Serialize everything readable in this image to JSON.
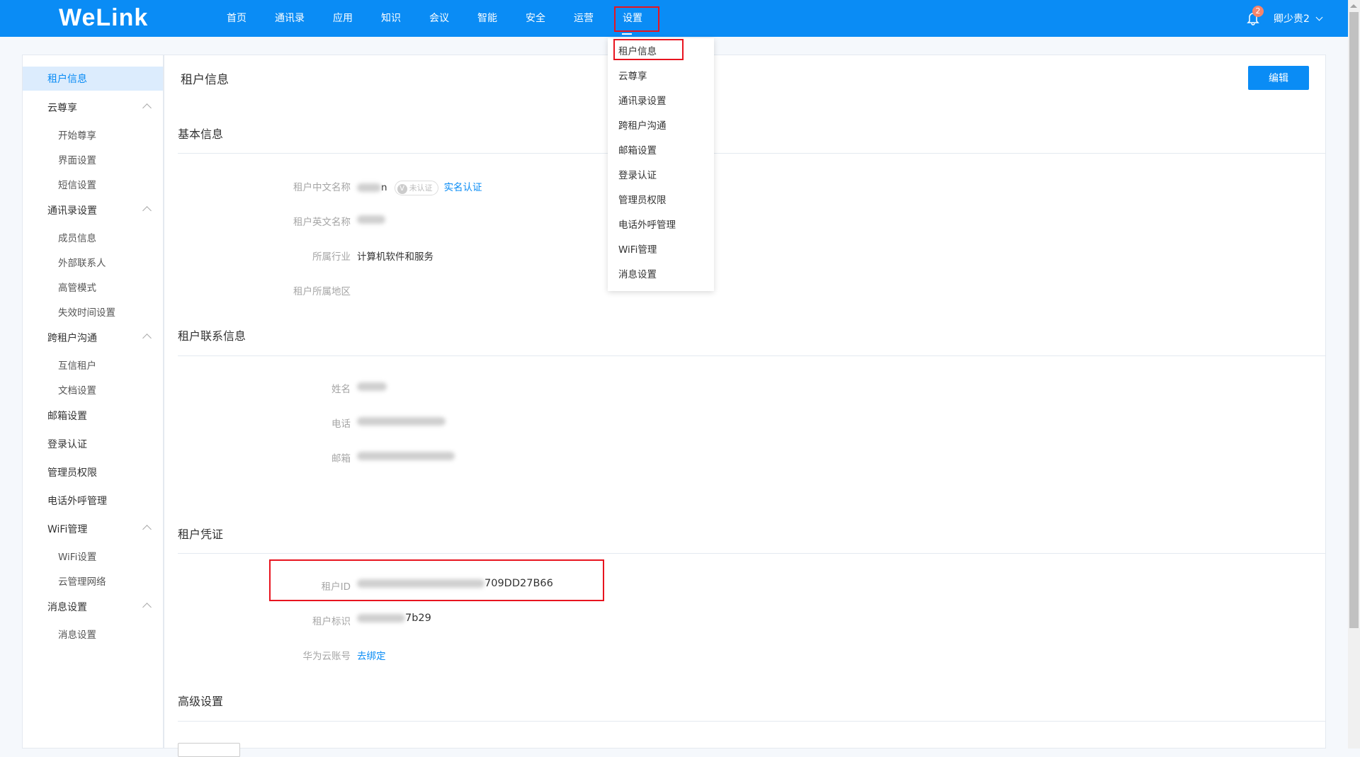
{
  "header": {
    "logo": "WeLink",
    "nav": [
      "首页",
      "通讯录",
      "应用",
      "知识",
      "会议",
      "智能",
      "安全",
      "运营",
      "设置"
    ],
    "active_nav": "设置",
    "notification_count": "2",
    "user": "卿少贵2"
  },
  "sidebar": {
    "items": [
      {
        "label": "租户信息",
        "level": 1,
        "active": true
      },
      {
        "label": "云尊享",
        "level": 1,
        "expand": true
      },
      {
        "label": "开始尊享",
        "level": 2
      },
      {
        "label": "界面设置",
        "level": 2
      },
      {
        "label": "短信设置",
        "level": 2
      },
      {
        "label": "通讯录设置",
        "level": 1,
        "expand": true
      },
      {
        "label": "成员信息",
        "level": 2
      },
      {
        "label": "外部联系人",
        "level": 2
      },
      {
        "label": "高管模式",
        "level": 2
      },
      {
        "label": "失效时间设置",
        "level": 2
      },
      {
        "label": "跨租户沟通",
        "level": 1,
        "expand": true
      },
      {
        "label": "互信租户",
        "level": 2
      },
      {
        "label": "文档设置",
        "level": 2
      },
      {
        "label": "邮箱设置",
        "level": 1
      },
      {
        "label": "登录认证",
        "level": 1
      },
      {
        "label": "管理员权限",
        "level": 1
      },
      {
        "label": "电话外呼管理",
        "level": 1
      },
      {
        "label": "WiFi管理",
        "level": 1,
        "expand": true
      },
      {
        "label": "WiFi设置",
        "level": 2
      },
      {
        "label": "云管理网络",
        "level": 2
      },
      {
        "label": "消息设置",
        "level": 1,
        "expand": true
      },
      {
        "label": "消息设置",
        "level": 2
      }
    ]
  },
  "dropdown": {
    "items": [
      "租户信息",
      "云尊享",
      "通讯录设置",
      "跨租户沟通",
      "邮箱设置",
      "登录认证",
      "管理员权限",
      "电话外呼管理",
      "WiFi管理",
      "消息设置"
    ]
  },
  "main": {
    "title": "租户信息",
    "edit": "编辑",
    "basic": {
      "heading": "基本信息",
      "cn_name_label": "租户中文名称",
      "cn_name_visible": "n",
      "unverified": "未认证",
      "verify_link": "实名认证",
      "en_name_label": "租户英文名称",
      "industry_label": "所属行业",
      "industry": "计算机软件和服务",
      "region_label": "租户所属地区"
    },
    "contact": {
      "heading": "租户联系信息",
      "name_label": "姓名",
      "phone_label": "电话",
      "email_label": "邮箱"
    },
    "credential": {
      "heading": "租户凭证",
      "id_label": "租户ID",
      "id_visible": "709DD27B66",
      "tag_label": "租户标识",
      "tag_visible": "7b29",
      "cloud_label": "华为云账号",
      "cloud_link": "去绑定"
    },
    "advanced": {
      "heading": "高级设置"
    }
  }
}
